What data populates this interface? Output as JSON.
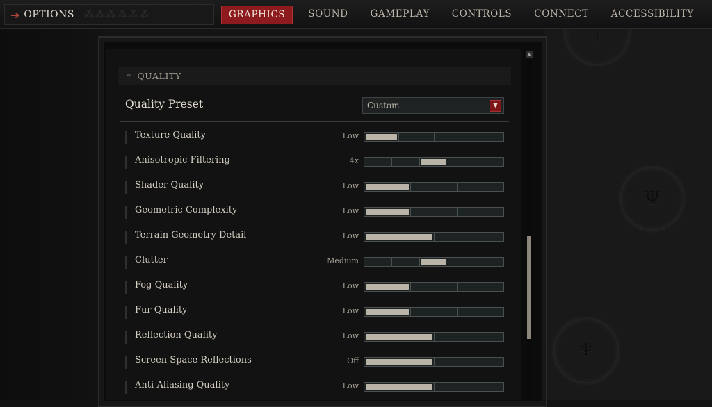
{
  "topbar": {
    "title": "OPTIONS",
    "back_icon": "arrow-right-icon",
    "tabs": [
      {
        "label": "GRAPHICS",
        "active": true
      },
      {
        "label": "SOUND",
        "active": false
      },
      {
        "label": "GAMEPLAY",
        "active": false
      },
      {
        "label": "CONTROLS",
        "active": false
      },
      {
        "label": "CONNECT",
        "active": false
      },
      {
        "label": "ACCESSIBILITY",
        "active": false
      }
    ]
  },
  "colors": {
    "accent_red": "#8d1a1c",
    "bar_fill": "#b9b3a8",
    "text": "#d4cec2"
  },
  "section": {
    "label": "QUALITY"
  },
  "preset": {
    "label": "Quality Preset",
    "value": "Custom"
  },
  "settings": [
    {
      "label": "Texture Quality",
      "value": "Low",
      "segments": 4,
      "selected": 1
    },
    {
      "label": "Anisotropic Filtering",
      "value": "4x",
      "segments": 5,
      "selected": 3
    },
    {
      "label": "Shader Quality",
      "value": "Low",
      "segments": 3,
      "selected": 1
    },
    {
      "label": "Geometric Complexity",
      "value": "Low",
      "segments": 3,
      "selected": 1
    },
    {
      "label": "Terrain Geometry Detail",
      "value": "Low",
      "segments": 2,
      "selected": 1
    },
    {
      "label": "Clutter",
      "value": "Medium",
      "segments": 5,
      "selected": 3
    },
    {
      "label": "Fog Quality",
      "value": "Low",
      "segments": 3,
      "selected": 1
    },
    {
      "label": "Fur Quality",
      "value": "Low",
      "segments": 3,
      "selected": 1
    },
    {
      "label": "Reflection Quality",
      "value": "Low",
      "segments": 2,
      "selected": 1
    },
    {
      "label": "Screen Space Reflections",
      "value": "Off",
      "segments": 2,
      "selected": 1
    },
    {
      "label": "Anti-Aliasing Quality",
      "value": "Low",
      "segments": 2,
      "selected": 1
    }
  ],
  "scroll": {
    "position_fraction": 0.55
  }
}
